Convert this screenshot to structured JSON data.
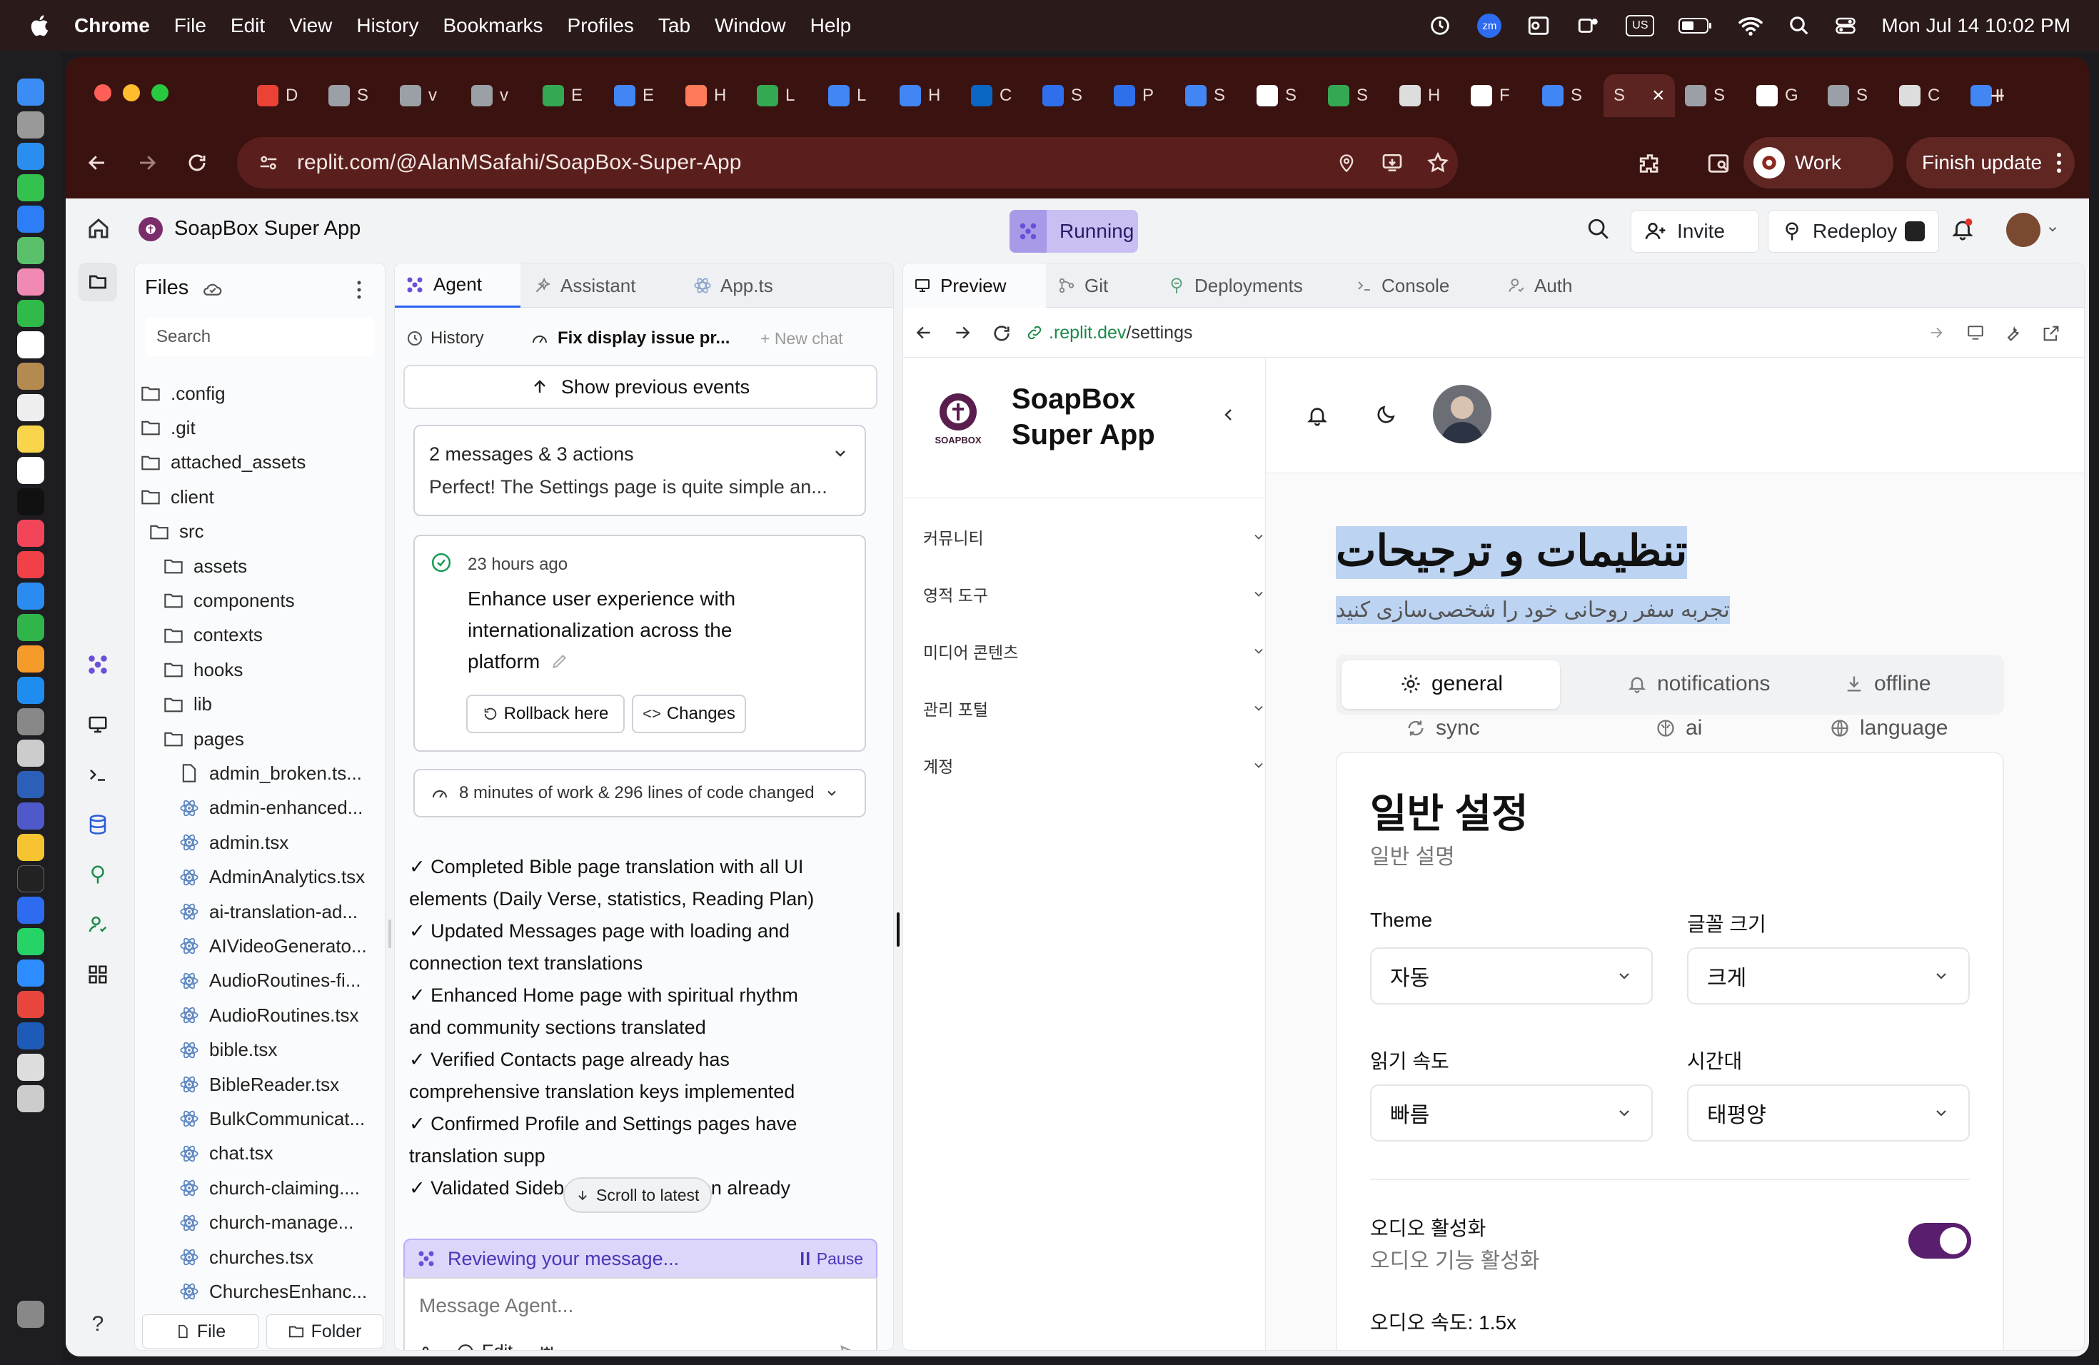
{
  "menubar": {
    "app": "Chrome",
    "items": [
      "File",
      "Edit",
      "View",
      "History",
      "Bookmarks",
      "Profiles",
      "Tab",
      "Window",
      "Help"
    ],
    "zm": "zm",
    "us": "US",
    "clock": "Mon Jul 14  10:02 PM"
  },
  "browser": {
    "url": "replit.com/@AlanMSafahi/SoapBox-Super-App",
    "tabs": [
      "D",
      "S",
      "v",
      "v",
      "E",
      "E",
      "H",
      "L",
      "L",
      "H",
      "C",
      "S",
      "P",
      "S",
      "S",
      "S",
      "H",
      "F",
      "S",
      "S",
      "S",
      "G",
      "S",
      "C",
      "I"
    ],
    "profile": "Work",
    "finish_update": "Finish update"
  },
  "replit": {
    "project_name": "SoapBox Super App",
    "status": "Running",
    "invite": "Invite",
    "redeploy": "Redeploy",
    "files": {
      "title": "Files",
      "search_placeholder": "Search",
      "tree": [
        {
          "name": ".config",
          "type": "folder",
          "depth": 0
        },
        {
          "name": ".git",
          "type": "folder",
          "depth": 0
        },
        {
          "name": "attached_assets",
          "type": "folder",
          "depth": 0
        },
        {
          "name": "client",
          "type": "folder",
          "depth": 0
        },
        {
          "name": "src",
          "type": "folder",
          "depth": 1
        },
        {
          "name": "assets",
          "type": "folder",
          "depth": 2
        },
        {
          "name": "components",
          "type": "folder",
          "depth": 2
        },
        {
          "name": "contexts",
          "type": "folder",
          "depth": 2
        },
        {
          "name": "hooks",
          "type": "folder",
          "depth": 2
        },
        {
          "name": "lib",
          "type": "folder",
          "depth": 2
        },
        {
          "name": "pages",
          "type": "folder",
          "depth": 2
        },
        {
          "name": "admin_broken.ts...",
          "type": "file",
          "depth": 3
        },
        {
          "name": "admin-enhanced...",
          "type": "react",
          "depth": 3
        },
        {
          "name": "admin.tsx",
          "type": "react",
          "depth": 3
        },
        {
          "name": "AdminAnalytics.tsx",
          "type": "react",
          "depth": 3
        },
        {
          "name": "ai-translation-ad...",
          "type": "react",
          "depth": 3
        },
        {
          "name": "AIVideoGenerato...",
          "type": "react",
          "depth": 3
        },
        {
          "name": "AudioRoutines-fi...",
          "type": "react",
          "depth": 3
        },
        {
          "name": "AudioRoutines.tsx",
          "type": "react",
          "depth": 3
        },
        {
          "name": "bible.tsx",
          "type": "react",
          "depth": 3
        },
        {
          "name": "BibleReader.tsx",
          "type": "react",
          "depth": 3
        },
        {
          "name": "BulkCommunicat...",
          "type": "react",
          "depth": 3
        },
        {
          "name": "chat.tsx",
          "type": "react",
          "depth": 3
        },
        {
          "name": "church-claiming....",
          "type": "react",
          "depth": 3
        },
        {
          "name": "church-manage...",
          "type": "react",
          "depth": 3
        },
        {
          "name": "churches.tsx",
          "type": "react",
          "depth": 3
        },
        {
          "name": "ChurchesEnhanc...",
          "type": "react",
          "depth": 3
        }
      ],
      "new_file": "File",
      "new_folder": "Folder"
    },
    "agent": {
      "tabs": [
        "Agent",
        "Assistant",
        "App.ts"
      ],
      "history": "History",
      "chat_title": "Fix display issue pr...",
      "new_chat": "+ New chat",
      "show_previous": "Show previous events",
      "summary_count": "2 messages & 3 actions",
      "summary_text": "Perfect! The Settings page is quite simple an...",
      "checkpoint_time": "23 hours ago",
      "checkpoint_lines": [
        "Enhance user experience with",
        "internationalization across the",
        "platform"
      ],
      "rollback": "Rollback here",
      "changes": "Changes",
      "work_summary": "8 minutes of work & 296 lines of code changed",
      "message_lines": [
        "✓ Completed Bible page translation with all UI",
        "elements (Daily Verse, statistics, Reading Plan)",
        "✓ Updated Messages page with loading and",
        "connection text translations",
        "✓ Enhanced Home page with spiritual rhythm",
        "and community sections translated",
        "✓ Verified Contacts page already has",
        "comprehensive translation keys implemented",
        "✓ Confirmed Profile and Settings pages have",
        "translation supp",
        "✓ Validated SidebarFixed navigation already"
      ],
      "scroll_latest": "Scroll to latest",
      "reviewing": "Reviewing your message...",
      "pause": "Pause",
      "input_placeholder": "Message Agent...",
      "edit": "Edit"
    },
    "preview": {
      "tabs": [
        "Preview",
        "Git",
        "Deployments",
        "Console",
        "Auth"
      ],
      "url_prefix": ".replit.dev",
      "url_path": "/settings",
      "app": {
        "logo_text": "SOAPBOX",
        "name_line1": "SoapBox",
        "name_line2": "Super App",
        "sidebar": [
          "커뮤니티",
          "영적 도구",
          "미디어 콘텐츠",
          "관리 포털",
          "계정"
        ],
        "title": "تنظیمات و ترجیحات",
        "subtitle": "تجربه سفر روحانی خود را شخصی‌سازی کنید",
        "settings_tabs": [
          "general",
          "notifications",
          "offline",
          "sync",
          "ai",
          "language"
        ],
        "section_title": "일반 설정",
        "section_desc": "일반 설명",
        "fields": [
          {
            "label": "Theme",
            "value": "자동"
          },
          {
            "label": "글꼴 크기",
            "value": "크게"
          },
          {
            "label": "읽기 속도",
            "value": "빠름"
          },
          {
            "label": "시간대",
            "value": "태평양"
          }
        ],
        "audio_label": "오디오 활성화",
        "audio_desc": "오디오 기능 활성화",
        "audio_enabled": true,
        "audio_speed": "오디오 속도: 1.5x"
      }
    }
  }
}
